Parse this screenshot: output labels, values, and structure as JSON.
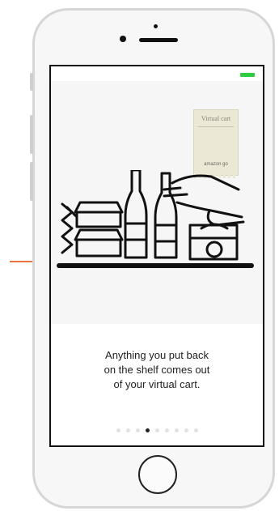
{
  "onboarding": {
    "receipt_title": "Virtual cart",
    "receipt_logo": "amazon go",
    "caption_line1": "Anything you put back",
    "caption_line2": "on the shelf comes out",
    "caption_line3": "of your virtual cart."
  },
  "pagination": {
    "total": 9,
    "active_index": 3
  },
  "colors": {
    "battery": "#2ecc40",
    "pointer": "#e8743b"
  },
  "icons": [
    "battery-icon",
    "receipt-icon",
    "shelf-illustration",
    "home-button"
  ]
}
